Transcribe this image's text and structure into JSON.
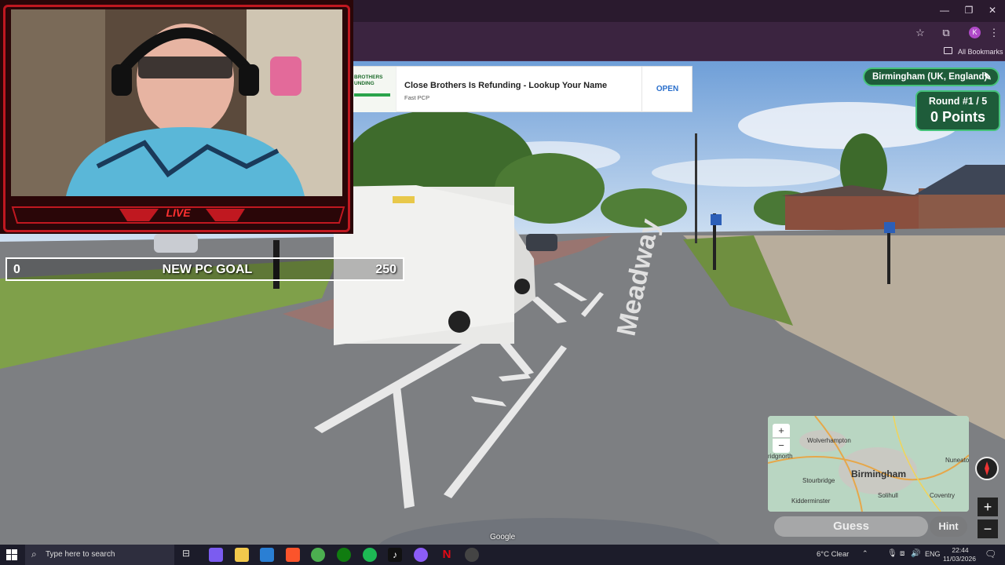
{
  "browser": {
    "bookmarks_label": "All Bookmarks",
    "profile_initial": "K",
    "icons": [
      "star-icon",
      "extensions-icon",
      "menu-icon"
    ]
  },
  "ad": {
    "thumb_text": "BROTHERS\nUNDING",
    "title": "Close Brothers Is Refunding - Lookup Your Name",
    "source": "Fast PCP",
    "cta": "OPEN"
  },
  "stream": {
    "live_label": "LIVE",
    "goal": {
      "start": "0",
      "title": "NEW PC GOAL",
      "end": "250"
    }
  },
  "game": {
    "location": "Birmingham (UK, England)",
    "round": "Round #1 / 5",
    "points": "0 Points",
    "guess_label": "Guess",
    "hint_label": "Hint",
    "street_sign": "Meadway",
    "google_mark": "Google",
    "map": {
      "labels": [
        "Wolverhampton",
        "Birmingham",
        "Stourbridge",
        "Solihull",
        "Coventry",
        "Nuneato",
        "Kidderminster",
        "ridgnorth"
      ],
      "zoom_in": "+",
      "zoom_out": "−"
    }
  },
  "taskbar": {
    "search_placeholder": "Type here to search",
    "weather": "6°C  Clear",
    "lang": "ENG",
    "time": "22:44",
    "date": "11/03/2026"
  },
  "colors": {
    "accent_green": "#46c27a",
    "panel_green": "#1e5c3a",
    "webcam_red": "#c01820",
    "browser_purple": "#3b2440"
  }
}
